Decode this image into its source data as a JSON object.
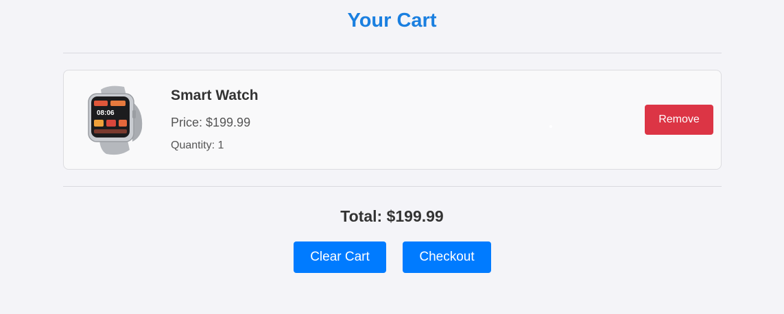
{
  "page": {
    "title": "Your Cart"
  },
  "cart": {
    "items": [
      {
        "name": "Smart Watch",
        "price": "Price: $199.99",
        "quantity": "Quantity: 1",
        "remove_label": "Remove",
        "image_icon": "smartwatch-image"
      }
    ]
  },
  "summary": {
    "total": "Total: $199.99",
    "clear_label": "Clear Cart",
    "checkout_label": "Checkout"
  },
  "colors": {
    "title": "#1a7fe0",
    "primary_button": "#007bff",
    "danger_button": "#dc3545",
    "background": "#f4f4f8"
  }
}
